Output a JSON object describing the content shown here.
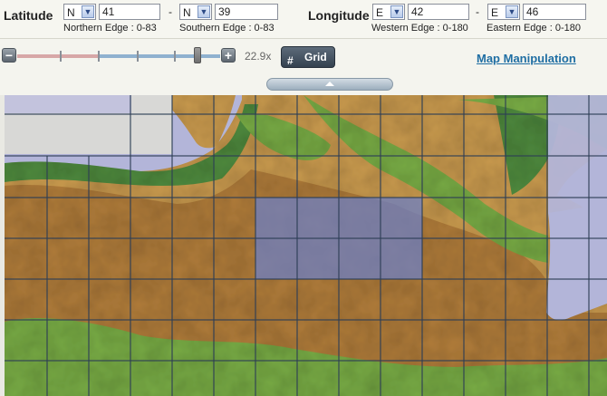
{
  "coords": {
    "latitude_label": "Latitude",
    "longitude_label": "Longitude",
    "dash": "-",
    "north_hemisphere": "N",
    "north_value": "41",
    "north_hint": "Northern Edge : 0-83",
    "south_hemisphere": "N",
    "south_value": "39",
    "south_hint": "Southern Edge : 0-83",
    "west_hemisphere": "E",
    "west_value": "42",
    "west_hint": "Western Edge : 0-180",
    "east_hemisphere": "E",
    "east_value": "46",
    "east_hint": "Eastern Edge : 0-180"
  },
  "controls": {
    "zoom_out": "−",
    "zoom_in": "+",
    "zoom_level": "22.9x",
    "zoom_fraction": 0.88,
    "grid_label": "Grid",
    "grid_icon": "#",
    "map_manipulation_link": "Map Manipulation"
  },
  "map": {
    "ocean_color": "#b3b5d9",
    "land_colors": [
      "#4f8a3e",
      "#78ab45",
      "#c99a4e",
      "#b07c3a"
    ],
    "grid_color": "#2e3f55",
    "selection_color": "#6e80c4"
  }
}
